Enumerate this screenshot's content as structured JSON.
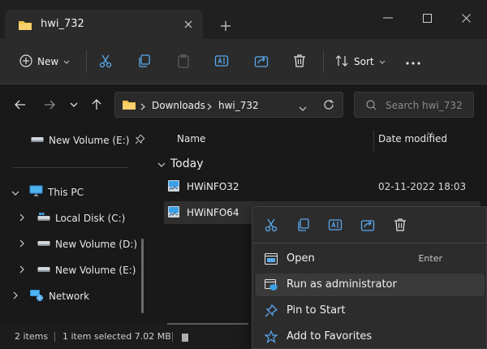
{
  "tab": {
    "title": "hwi_732"
  },
  "toolbar": {
    "new_label": "New",
    "sort_label": "Sort"
  },
  "address": {
    "crumbs": [
      "Downloads",
      "hwi_732"
    ]
  },
  "search": {
    "placeholder": "Search hwi_732"
  },
  "sidebar": {
    "pinned": {
      "label": "New Volume (E:)"
    },
    "items": [
      {
        "label": "This PC"
      },
      {
        "label": "Local Disk (C:)"
      },
      {
        "label": "New Volume (D:)"
      },
      {
        "label": "New Volume (E:)"
      },
      {
        "label": "Network"
      }
    ]
  },
  "columns": {
    "name": "Name",
    "date": "Date modified"
  },
  "group": {
    "label": "Today"
  },
  "files": [
    {
      "name": "HWiNFO32",
      "date": "02-11-2022 18:03"
    },
    {
      "name": "HWiNFO64",
      "date": ""
    }
  ],
  "status": {
    "count": "2 items",
    "selected": "1 item selected 7.02 MB"
  },
  "context_menu": {
    "items": [
      {
        "label": "Open",
        "shortcut": "Enter"
      },
      {
        "label": "Run as administrator"
      },
      {
        "label": "Pin to Start"
      },
      {
        "label": "Add to Favorites"
      }
    ]
  },
  "colors": {
    "accent": "#3aa0e8",
    "folder": "#f2c14e",
    "background": "#191919"
  }
}
